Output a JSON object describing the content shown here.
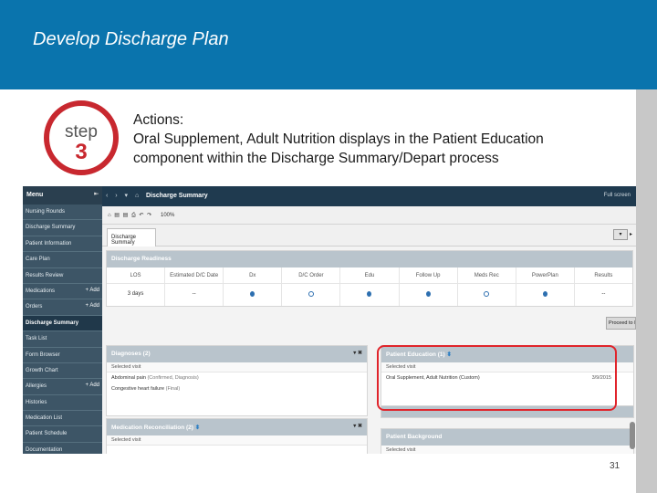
{
  "slide": {
    "title": "Develop Discharge Plan",
    "step_word": "step",
    "step_number": "3",
    "actions_heading": "Actions:",
    "actions_line1": "Oral Supplement, Adult Nutrition displays in the Patient Education",
    "actions_line2": "component within the Discharge Summary/Depart process",
    "page_number": "31",
    "colors": {
      "banner": "#0a74ad",
      "highlight": "#e0242b",
      "step_red": "#c8282f"
    }
  },
  "ehr": {
    "menu_title": "Menu",
    "menu_items": [
      {
        "label": "Nursing Rounds"
      },
      {
        "label": "Discharge Summary"
      },
      {
        "label": "Patient Information"
      },
      {
        "label": "Care Plan"
      },
      {
        "label": "Results Review"
      },
      {
        "label": "Medications",
        "add": "+ Add"
      },
      {
        "label": "Orders",
        "add": "+ Add"
      },
      {
        "label": "Discharge Summary",
        "active": true
      },
      {
        "label": "Task List"
      },
      {
        "label": "Form Browser"
      },
      {
        "label": "Growth Chart"
      },
      {
        "label": "Allergies",
        "add": "+ Add"
      },
      {
        "label": "Histories"
      },
      {
        "label": "Medication List"
      },
      {
        "label": "Patient Schedule"
      },
      {
        "label": "Documentation"
      }
    ],
    "nav_glyphs": "‹ › ▾ ⌂",
    "page_title": "Discharge Summary",
    "full_screen": "Full screen",
    "toolbar_tools": "⌂ ▤ ▤ ⎙ ↶ ↷",
    "zoom": "100%",
    "tab_label": "Discharge Summary",
    "readiness": {
      "title": "Discharge Readiness",
      "headers": [
        "LOS",
        "Estimated D/C Date",
        "Dx",
        "D/C Order",
        "Edu",
        "Follow Up",
        "Meds Rec",
        "PowerPlan",
        "Results"
      ],
      "values": [
        "3 days",
        "--",
        "dot",
        "ring",
        "dot",
        "dot",
        "ring",
        "dot",
        "--"
      ]
    },
    "proceed_button": "Proceed to Discharge",
    "diagnoses": {
      "title": "Diagnoses (2)",
      "selected_visit": "Selected visit",
      "rows": [
        {
          "name": "Abdominal pain",
          "detail": "(Confirmed, Diagnosis)"
        },
        {
          "name": "Congestive heart failure",
          "detail": "(Final)"
        }
      ]
    },
    "med_rec": {
      "title": "Medication Reconciliation (2)",
      "selected_visit": "Selected visit"
    },
    "patient_education": {
      "title": "Patient Education (1)",
      "selected_visit": "Selected visit",
      "row": "Oral Supplement, Adult Nutrition (Custom)",
      "date": "3/9/2015"
    },
    "patient_background": {
      "title": "Patient Background",
      "selected_visit": "Selected visit"
    }
  }
}
